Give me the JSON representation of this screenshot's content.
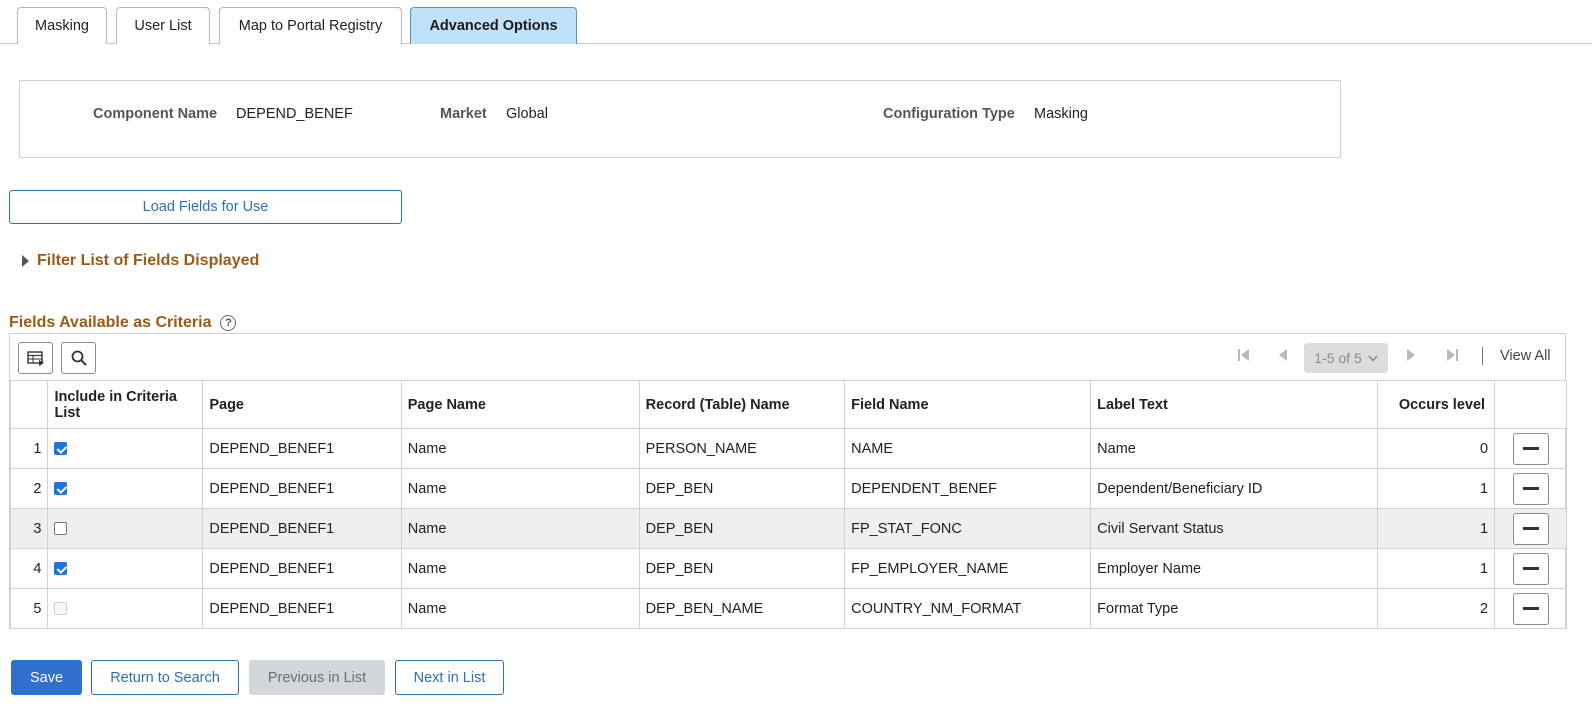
{
  "tabs": [
    {
      "label": "Masking",
      "active": false
    },
    {
      "label": "User List",
      "active": false
    },
    {
      "label": "Map to Portal Registry",
      "active": false
    },
    {
      "label": "Advanced Options",
      "active": true
    }
  ],
  "info": {
    "component_name_label": "Component Name",
    "component_name_value": "DEPEND_BENEF",
    "market_label": "Market",
    "market_value": "Global",
    "config_type_label": "Configuration Type",
    "config_type_value": "Masking"
  },
  "load_fields_button": "Load Fields for Use",
  "filter_section": {
    "label": "Filter List of Fields Displayed",
    "expanded": false
  },
  "fields_section": {
    "title": "Fields Available as Criteria",
    "help_icon": "?"
  },
  "grid_toolbar": {
    "personalize_icon": "grid-settings-icon",
    "search_icon": "search-icon",
    "page_range": "1-5 of 5",
    "view_all": "View All"
  },
  "columns": [
    "Include in Criteria List",
    "Page",
    "Page Name",
    "Record (Table) Name",
    "Field Name",
    "Label Text",
    "Occurs level"
  ],
  "rows": [
    {
      "num": "1",
      "checked": "true",
      "page": "DEPEND_BENEF1",
      "page_name": "Name",
      "record": "PERSON_NAME",
      "field": "NAME",
      "label": "Name",
      "occurs": "0"
    },
    {
      "num": "2",
      "checked": "true",
      "page": "DEPEND_BENEF1",
      "page_name": "Name",
      "record": "DEP_BEN",
      "field": "DEPENDENT_BENEF",
      "label": "Dependent/Beneficiary ID",
      "occurs": "1"
    },
    {
      "num": "3",
      "checked": "false",
      "page": "DEPEND_BENEF1",
      "page_name": "Name",
      "record": "DEP_BEN",
      "field": "FP_STAT_FONC",
      "label": "Civil Servant Status",
      "occurs": "1"
    },
    {
      "num": "4",
      "checked": "true",
      "page": "DEPEND_BENEF1",
      "page_name": "Name",
      "record": "DEP_BEN",
      "field": "FP_EMPLOYER_NAME",
      "label": "Employer Name",
      "occurs": "1"
    },
    {
      "num": "5",
      "checked": "disabled",
      "page": "DEPEND_BENEF1",
      "page_name": "Name",
      "record": "DEP_BEN_NAME",
      "field": "COUNTRY_NM_FORMAT",
      "label": "Format Type",
      "occurs": "2"
    }
  ],
  "actions": {
    "save": "Save",
    "return_to_search": "Return to Search",
    "previous_in_list": "Previous in List",
    "next_in_list": "Next in List"
  },
  "colors": {
    "accent": "#2e6fcf",
    "section_title": "#9c5a13",
    "active_tab": "#bfe1fb"
  }
}
